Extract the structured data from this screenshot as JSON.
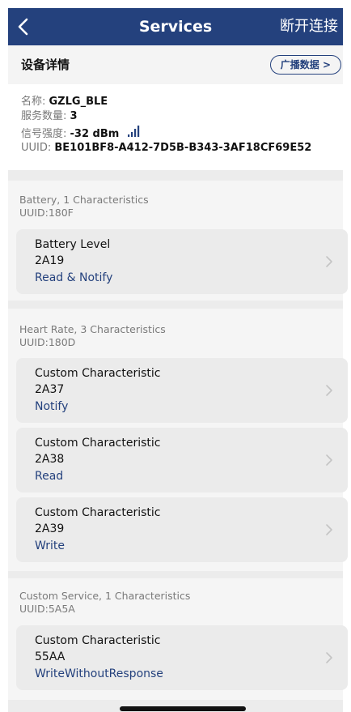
{
  "navbar": {
    "back_icon": "chevron-left-icon",
    "title": "Services",
    "action_label": "断开连接",
    "background": "#24417d"
  },
  "device_header": {
    "title": "设备详情",
    "adv_button_label": "广播数据 >"
  },
  "device_info": {
    "name_label": "名称: ",
    "name_value": "GZLG_BLE",
    "services_label": "服务数量: ",
    "services_value": "3",
    "rssi_label": "信号强度: ",
    "rssi_value": "-32 dBm",
    "rssi_icon": "signal-bars-icon",
    "uuid_label": "UUID: ",
    "uuid_value": "BE101BF8-A412-7D5B-B343-3AF18CF69E52"
  },
  "services": [
    {
      "title": "Battery, 1 Characteristics",
      "uuid": "UUID:180F",
      "characteristics": [
        {
          "name": "Battery Level",
          "uuid": "2A19",
          "properties": "Read & Notify"
        }
      ]
    },
    {
      "title": "Heart Rate, 3 Characteristics",
      "uuid": "UUID:180D",
      "characteristics": [
        {
          "name": "Custom Characteristic",
          "uuid": "2A37",
          "properties": "Notify"
        },
        {
          "name": "Custom Characteristic",
          "uuid": "2A38",
          "properties": "Read"
        },
        {
          "name": "Custom Characteristic",
          "uuid": "2A39",
          "properties": "Write"
        }
      ]
    },
    {
      "title": "Custom Service, 1 Characteristics",
      "uuid": "UUID:5A5A",
      "characteristics": [
        {
          "name": "Custom Characteristic",
          "uuid": "55AA",
          "properties": "WriteWithoutResponse"
        }
      ]
    }
  ],
  "colors": {
    "accent": "#24417d",
    "card": "#ebebeb",
    "section": "#f5f5f5",
    "muted_text": "#7a7a7a"
  }
}
